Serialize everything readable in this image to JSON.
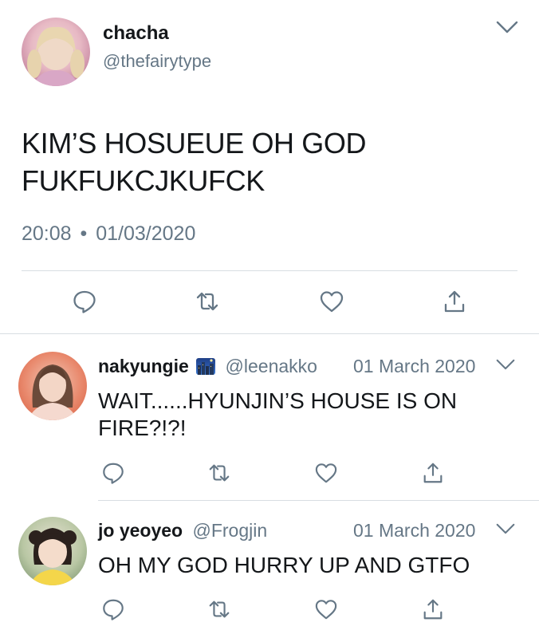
{
  "main_tweet": {
    "name": "chacha",
    "handle": "@thefairytype",
    "text_line1": "KIM’S HOSUEUE OH GOD",
    "text_line2": "FUKFUKCJKUFCK",
    "time": "20:08",
    "separator": "•",
    "date": "01/03/2020"
  },
  "replies": [
    {
      "name": "nakyungie",
      "handle": "@leenakko",
      "date": "01 March 2020",
      "text_line1": "WAIT......HYUNJIN’S HOUSE IS ON",
      "text_line2": "FIRE?!?!"
    },
    {
      "name": "jo yeoyeo",
      "handle": "@Frogjin",
      "date": "01 March 2020",
      "text_line1": "OH MY GOD HURRY UP AND GTFO"
    }
  ],
  "icons": {
    "reply": "speech-bubble-icon",
    "retweet": "retweet-arrows-icon",
    "like": "heart-icon",
    "share": "share-upload-icon",
    "menu": "chevron-down-icon"
  },
  "colors": {
    "icon": "#657786",
    "text": "#14171a",
    "muted": "#657786",
    "divider": "#d8dde2"
  }
}
